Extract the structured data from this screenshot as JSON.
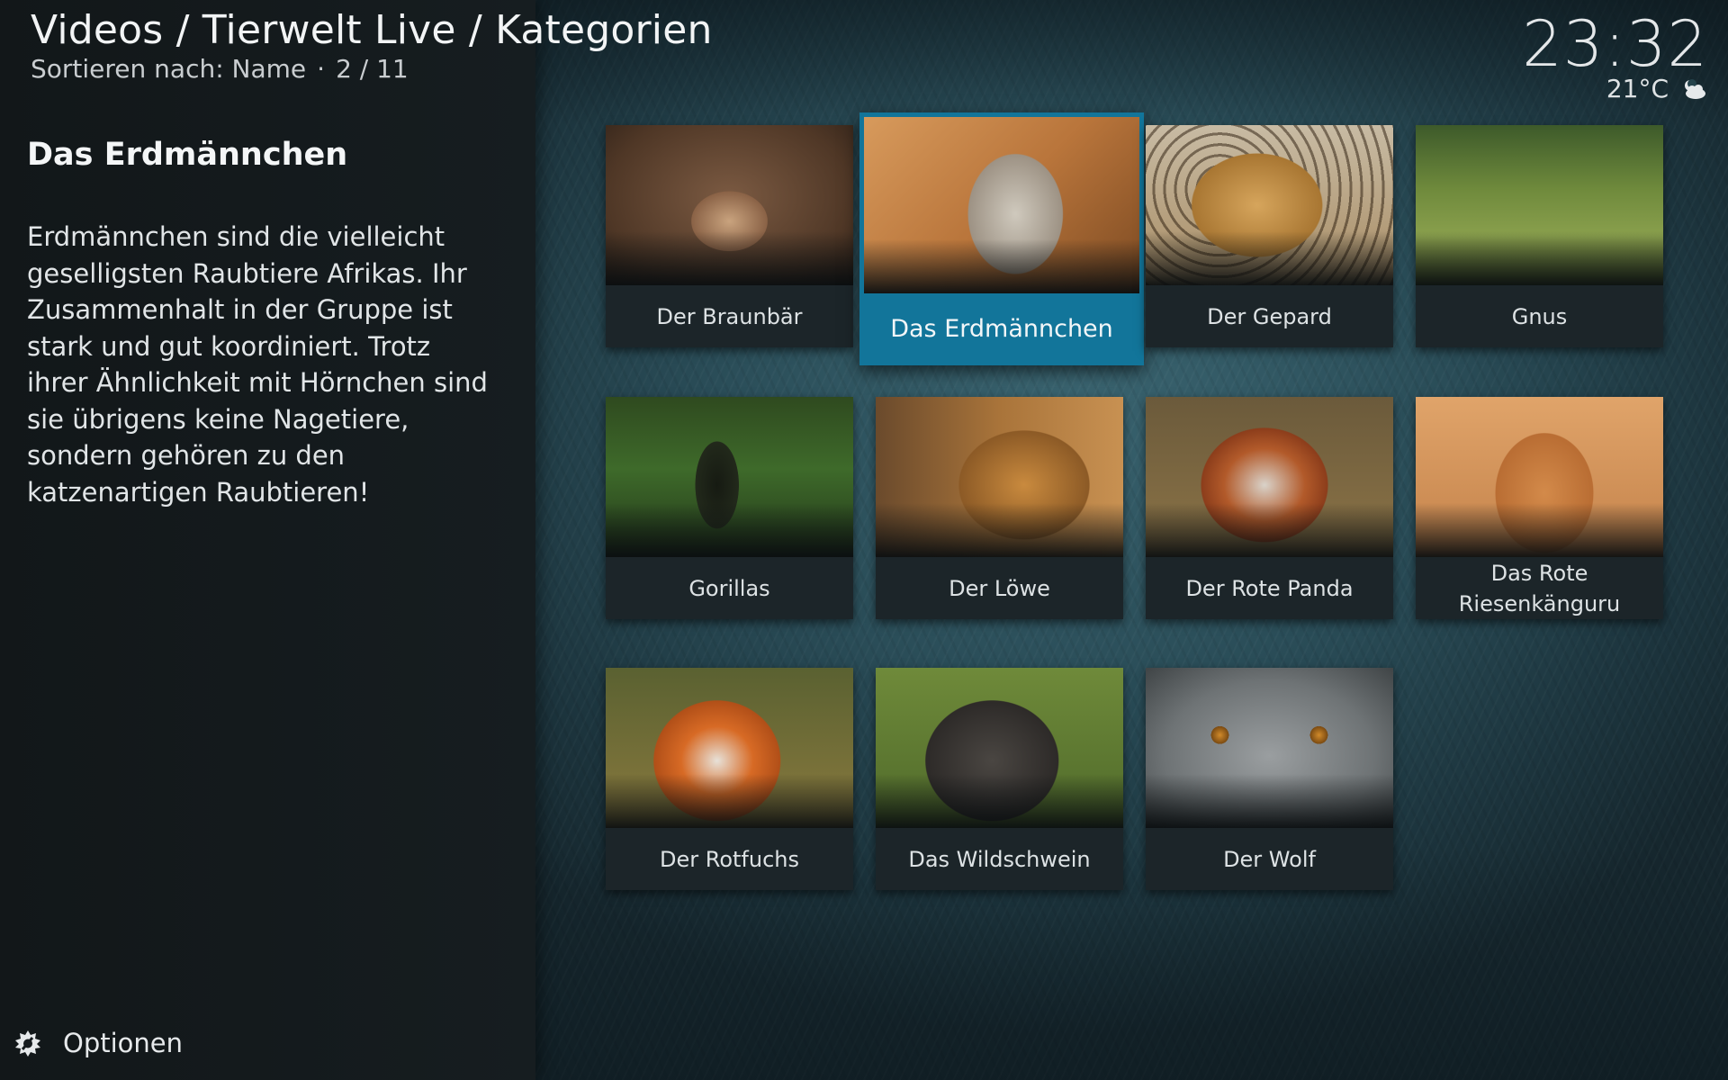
{
  "header": {
    "breadcrumb": "Videos / Tierwelt Live / Kategorien",
    "sort_label": "Sortieren nach: Name",
    "separator": "·",
    "position": "2 / 11"
  },
  "clock": {
    "time": "23:32",
    "temperature": "21°C",
    "weather_icon": "partly-cloudy-night-icon"
  },
  "info": {
    "title": "Das Erdmännchen",
    "description": "Erdmännchen sind die vielleicht geselligsten Raubtiere Afrikas. Ihr Zusammenhalt in der Gruppe ist stark und gut koordiniert. Trotz ihrer Ähnlichkeit mit Hörnchen sind sie übrigens keine Nagetiere, sondern gehören zu den katzenartigen Raubtieren!"
  },
  "options": {
    "label": "Optionen",
    "icon": "options-gear-icon"
  },
  "accent_color": "#12759a",
  "categories": [
    {
      "label": "Der Braunbär"
    },
    {
      "label": "Das Erdmännchen",
      "focused": true
    },
    {
      "label": "Der Gepard"
    },
    {
      "label": "Gnus"
    },
    {
      "label": "Gorillas"
    },
    {
      "label": "Der Löwe"
    },
    {
      "label": "Der Rote Panda"
    },
    {
      "label": "Das Rote Riesenkänguru"
    },
    {
      "label": "Der Rotfuchs"
    },
    {
      "label": "Das Wildschwein"
    },
    {
      "label": "Der Wolf"
    }
  ]
}
